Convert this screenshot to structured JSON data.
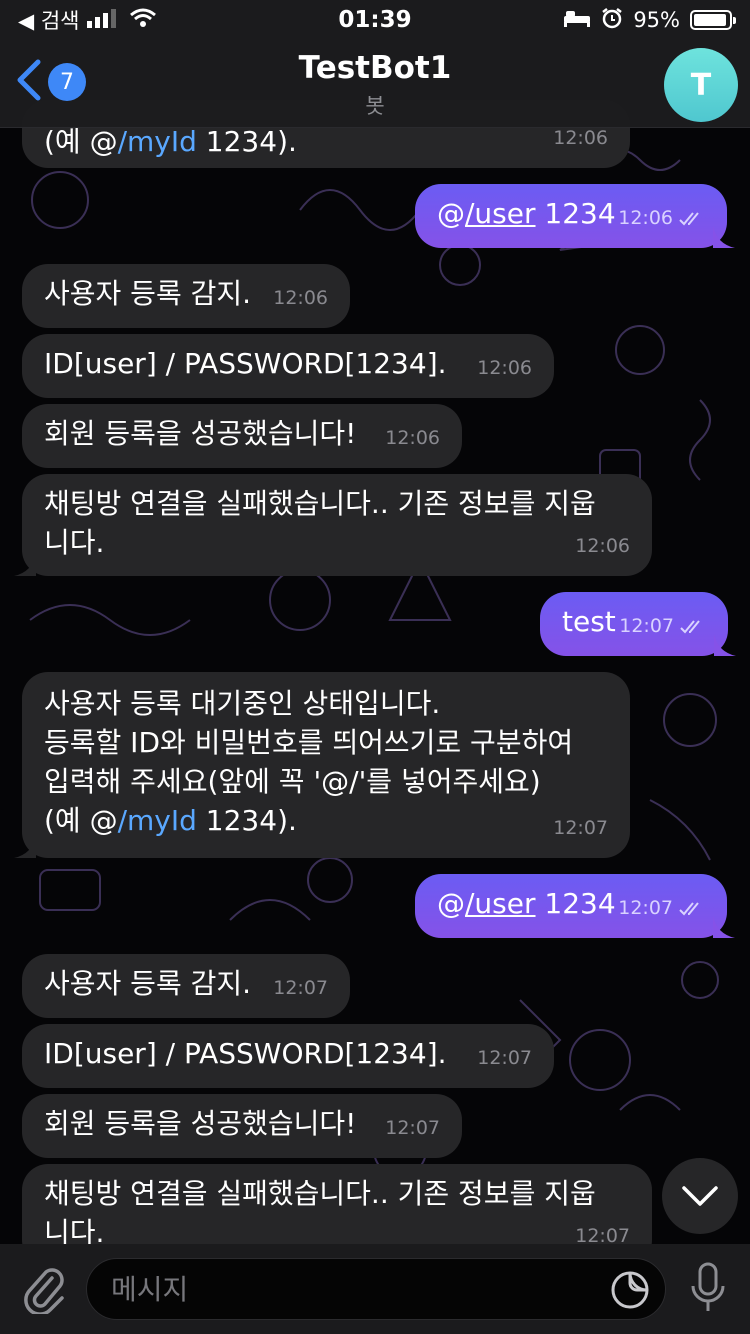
{
  "status_bar": {
    "back_app": "◀ 검색",
    "time": "01:39",
    "battery_text": "95%",
    "battery_level": 0.95
  },
  "header": {
    "back_count": "7",
    "title": "TestBot1",
    "subtitle": "봇",
    "avatar_letter": "T"
  },
  "colors": {
    "accent": "#3e88f7",
    "outgoing_bubble": "#7b55ee",
    "incoming_bubble": "#262628",
    "link": "#5aa8ff"
  },
  "messages": [
    {
      "dir": "in",
      "lines": [
        "(예 @/myId 1234)."
      ],
      "time": "12:06"
    },
    {
      "dir": "out",
      "text_prefix": "@",
      "mention": "/user",
      "text_suffix": " 1234",
      "time": "12:06"
    },
    {
      "dir": "in",
      "lines": [
        "사용자 등록 감지."
      ],
      "time": "12:06"
    },
    {
      "dir": "in",
      "lines": [
        "ID[user] / PASSWORD[1234]."
      ],
      "time": "12:06"
    },
    {
      "dir": "in",
      "lines": [
        "회원 등록을 성공했습니다!"
      ],
      "time": "12:06"
    },
    {
      "dir": "in",
      "lines": [
        "채팅방 연결을 실패했습니다.. 기존 정보를 지웁",
        "니다."
      ],
      "time": "12:06"
    },
    {
      "dir": "out",
      "text": "test",
      "time": "12:07"
    },
    {
      "dir": "in",
      "lines": [
        "사용자 등록 대기중인 상태입니다.",
        "등록할 ID와 비밀번호를 띄어쓰기로 구분하여",
        "입력해 주세요(앞에 꼭 '@/'를 넣어주세요)",
        "(예 @/myId 1234)."
      ],
      "time": "12:07"
    },
    {
      "dir": "out",
      "text_prefix": "@",
      "mention": "/user",
      "text_suffix": " 1234",
      "time": "12:07"
    },
    {
      "dir": "in",
      "lines": [
        "사용자 등록 감지."
      ],
      "time": "12:07"
    },
    {
      "dir": "in",
      "lines": [
        "ID[user] / PASSWORD[1234]."
      ],
      "time": "12:07"
    },
    {
      "dir": "in",
      "lines": [
        "회원 등록을 성공했습니다!"
      ],
      "time": "12:07"
    },
    {
      "dir": "in",
      "lines": [
        "채팅방 연결을 실패했습니다.. 기존 정보를 지웁",
        "니다."
      ],
      "time": "12:07"
    }
  ],
  "link_parts": {
    "example_prefix": "(예 @",
    "example_link": "/myId",
    "example_suffix": " 1234)."
  },
  "input": {
    "placeholder": "메시지"
  },
  "icons": {
    "attach": "paperclip-icon",
    "sticker": "sticker-icon",
    "mic": "microphone-icon",
    "scroll": "chevron-down-icon",
    "back": "chevron-left-icon"
  }
}
